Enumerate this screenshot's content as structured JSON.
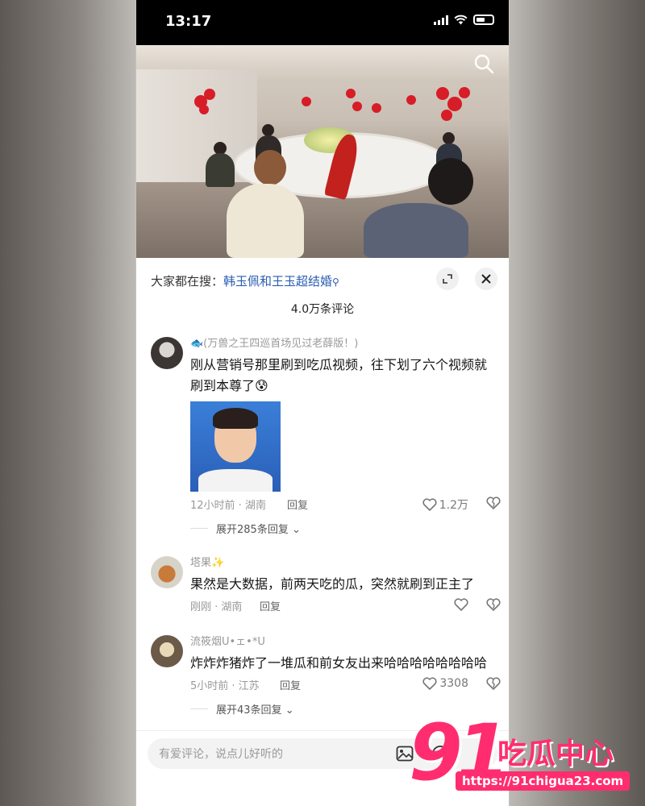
{
  "status_bar": {
    "time": "13:17"
  },
  "sheet": {
    "trending_prefix": "大家都在搜：",
    "trending_keyword": "韩玉佩和王玉超结婚",
    "comment_count": "4.0万条评论"
  },
  "comments": [
    {
      "username": "🐟(万兽之王四巡首场见过老薛版！)",
      "text_line1": "刚从营销号那里刷到吃瓜视频，往下划了六个视频就",
      "text_line2": "刷到本尊了😰",
      "time_location": "12小时前 · 湖南",
      "reply_label": "回复",
      "likes": "1.2万",
      "expand_label": "展开285条回复"
    },
    {
      "username": "塔果✨",
      "text": "果然是大数据，前两天吃的瓜，突然就刷到正主了",
      "time_location": "刚刚 · 湖南",
      "reply_label": "回复"
    },
    {
      "username": "流筱烟U•ェ•*U",
      "text": "炸炸炸猪炸了一堆瓜和前女友出来哈哈哈哈哈哈哈哈",
      "time_location": "5小时前 · 江苏",
      "reply_label": "回复",
      "likes": "3308",
      "expand_label": "展开43条回复"
    }
  ],
  "input": {
    "placeholder": "有爱评论，说点儿好听的"
  },
  "watermark": {
    "number": "91",
    "name": "吃瓜中心",
    "url": "https://91chigua23.com"
  },
  "colors": {
    "accent_link": "#2a5db0",
    "watermark": "#ff2d6f"
  }
}
